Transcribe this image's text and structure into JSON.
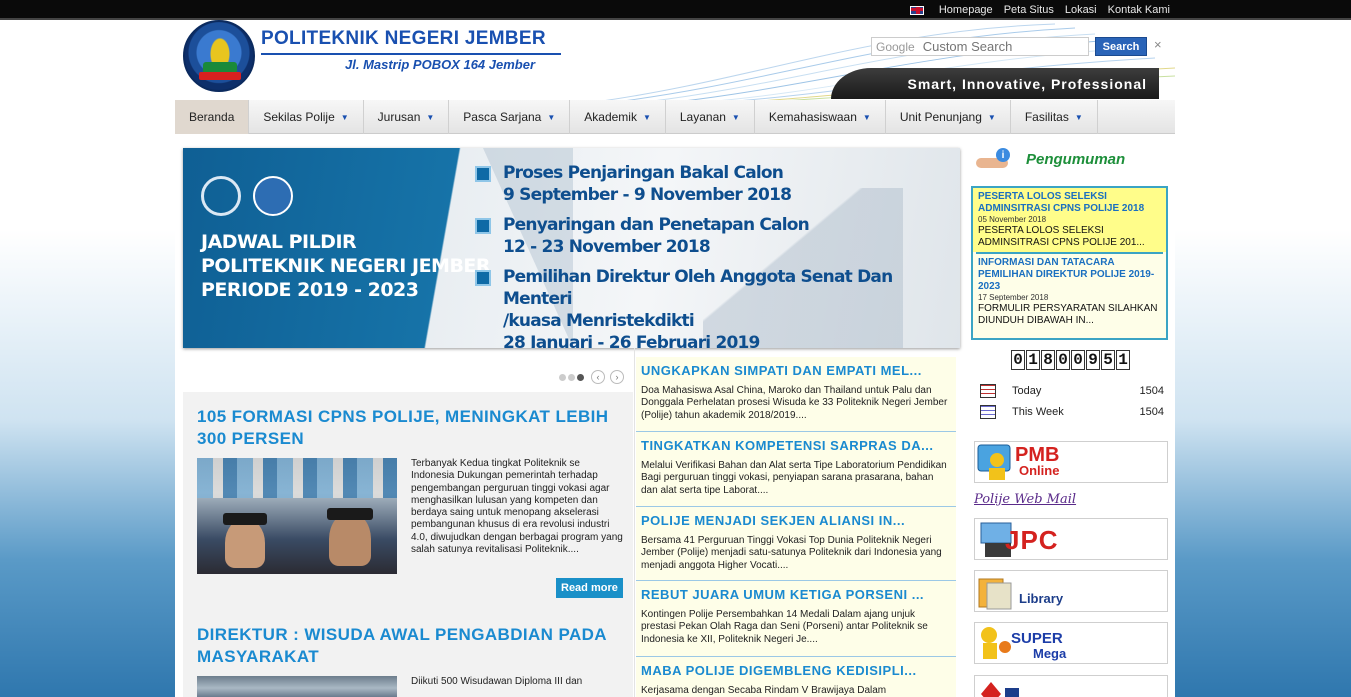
{
  "topbar": {
    "links": [
      "Homepage",
      "Peta Situs",
      "Lokasi",
      "Kontak Kami"
    ]
  },
  "header": {
    "site_name": "POLITEKNIK NEGERI JEMBER",
    "address": "Jl. Mastrip POBOX 164 Jember",
    "search_brand": "Google",
    "search_placeholder": "Custom Search",
    "search_button": "Search",
    "search_clear": "×",
    "tagline": "Smart, Innovative, Professional"
  },
  "nav": {
    "items": [
      {
        "label": "Beranda"
      },
      {
        "label": "Sekilas Polije"
      },
      {
        "label": "Jurusan"
      },
      {
        "label": "Pasca Sarjana"
      },
      {
        "label": "Akademik"
      },
      {
        "label": "Layanan"
      },
      {
        "label": "Kemahasiswaan"
      },
      {
        "label": "Unit Penunjang"
      },
      {
        "label": "Fasilitas"
      }
    ],
    "active_index": 0
  },
  "slider": {
    "title_lines": [
      "JADWAL PILDIR",
      "POLITEKNIK NEGERI JEMBER",
      "PERIODE 2019 - 2023"
    ],
    "items": [
      {
        "lines": [
          "Proses Penjaringan Bakal Calon",
          "9 September - 9 November 2018"
        ]
      },
      {
        "lines": [
          "Penyaringan dan Penetapan Calon",
          "12 - 23 November 2018"
        ]
      },
      {
        "lines": [
          "Pemilihan Direktur Oleh Anggota Senat Dan Menteri",
          "/kuasa Menristekdikti",
          "28 Januari - 26 Februari 2019"
        ]
      }
    ],
    "dots": 3,
    "active_dot": 2,
    "prev": "‹",
    "next": "›"
  },
  "featured": [
    {
      "title": "105 FORMASI CPNS POLIJE, MENINGKAT LEBIH 300 PERSEN",
      "excerpt": "Terbanyak Kedua tingkat Politeknik se Indonesia Dukungan pemerintah terhadap pengembangan perguruan tinggi vokasi agar menghasilkan lulusan yang kompeten dan berdaya saing untuk menopang akselerasi pembangunan khusus di era revolusi industri 4.0, diwujudkan dengan berbagai program yang salah satunya revitalisasi Politeknik...."
    },
    {
      "title": "DIREKTUR : WISUDA AWAL PENGABDIAN PADA MASYARAKAT",
      "excerpt": "Diikuti 500 Wisudawan Diploma III dan"
    }
  ],
  "read_more": "Read more",
  "news": [
    {
      "title": "UNGKAPKAN SIMPATI DAN EMPATI MEL...",
      "excerpt": "Doa Mahasiswa Asal China, Maroko dan Thailand untuk Palu dan Donggala Perhelatan prosesi Wisuda ke 33 Politeknik Negeri Jember (Polije) tahun akademik 2018/2019...."
    },
    {
      "title": "TINGKATKAN KOMPETENSI SARPRAS DA...",
      "excerpt": "Melalui Verifikasi Bahan dan Alat serta Tipe Laboratorium Pendidikan Bagi perguruan tinggi vokasi, penyiapan sarana prasarana, bahan dan alat serta tipe Laborat...."
    },
    {
      "title": "POLIJE MENJADI SEKJEN ALIANSI IN...",
      "excerpt": "Bersama 41 Perguruan Tinggi Vokasi Top Dunia Politeknik Negeri Jember (Polije) menjadi satu-satunya Politeknik dari Indonesia yang menjadi anggota Higher Vocati...."
    },
    {
      "title": "REBUT JUARA UMUM KETIGA PORSENI ...",
      "excerpt": "Kontingen Polije Persembahkan 14 Medali Dalam ajang unjuk prestasi Pekan Olah Raga dan Seni (Porseni) antar Politeknik se Indonesia ke XII, Politeknik Negeri Je...."
    },
    {
      "title": "MABA POLIJE DIGEMBLENG KEDISIPLI...",
      "excerpt": "Kerjasama dengan Secaba Rindam V Brawijaya Dalam"
    }
  ],
  "sidebar": {
    "pengumuman_title": "Pengumuman",
    "announcements": [
      {
        "title": "PESERTA LOLOS SELEKSI ADMINSITRASI CPNS POLIJE 2018",
        "date": "05 November 2018",
        "text": "PESERTA LOLOS SELEKSI ADMINSITRASI CPNS POLIJE 201..."
      },
      {
        "title": "INFORMASI DAN TATACARA PEMILIHAN DIREKTUR POLIJE 2019-2023",
        "date": "17 September 2018",
        "text": "FORMULIR PERSYARATAN SILAHKAN DIUNDUH DIBAWAH IN..."
      }
    ],
    "counter_digits": [
      "0",
      "1",
      "8",
      "0",
      "0",
      "9",
      "5",
      "1"
    ],
    "stats": [
      {
        "label": "Today",
        "value": "1504"
      },
      {
        "label": "This Week",
        "value": "1504"
      }
    ],
    "banners": {
      "pmb": {
        "title": "PMB",
        "sub": "Online"
      },
      "webmail": "Polije Web Mail",
      "jpc": "JPC",
      "library": "Library",
      "super": {
        "title": "SUPER",
        "sub": "Mega"
      }
    }
  }
}
